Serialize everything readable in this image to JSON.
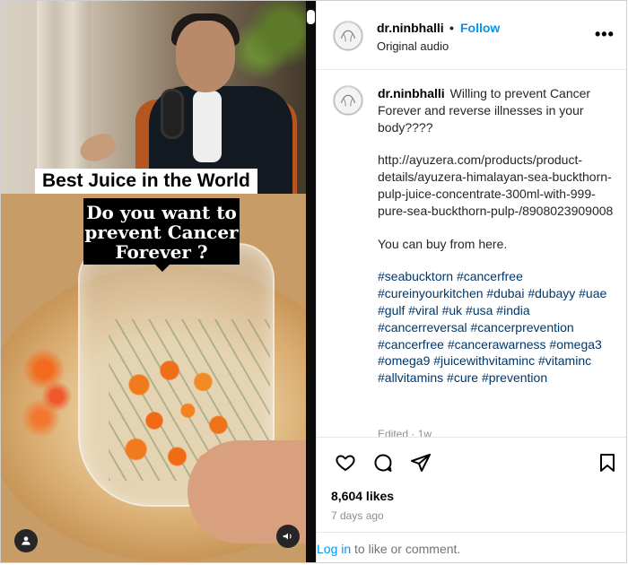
{
  "media": {
    "caption_top": "Best Juice in the World",
    "caption_question": "Do you want to prevent Cancer Forever ?",
    "icons": [
      "user-icon",
      "volume-icon"
    ]
  },
  "header": {
    "username": "dr.ninbhalli",
    "separator": "•",
    "follow_label": "Follow",
    "audio": "Original audio",
    "more": "•••"
  },
  "post": {
    "username": "dr.ninbhalli",
    "caption_intro": "Willing to prevent Cancer Forever and reverse illnesses in your body????",
    "link": "http://ayuzera.com/products/product-details/ayuzera-himalayan-sea-buckthorn-pulp-juice-concentrate-300ml-with-999-pure-sea-buckthorn-pulp-/8908023909008",
    "buy_line": "You can buy from here.",
    "hashtags": "#seabucktorn #cancerfree #cureinyourkitchen #dubai #dubayy #uae #gulf #viral #uk #usa #india #cancerreversal #cancerprevention #cancerfree #cancerawarness #omega3 #omega9 #juicewithvitaminc #vitaminc #allvitamins #cure #prevention",
    "edited": "Edited · 1w"
  },
  "actions": {
    "likes": "8,604 likes",
    "date": "7 days ago"
  },
  "footer": {
    "login_link": "Log in",
    "login_rest": " to like or comment."
  },
  "colors": {
    "link_blue": "#0095f6",
    "hashtag_blue": "#00376b",
    "muted": "#8e8e8e"
  }
}
